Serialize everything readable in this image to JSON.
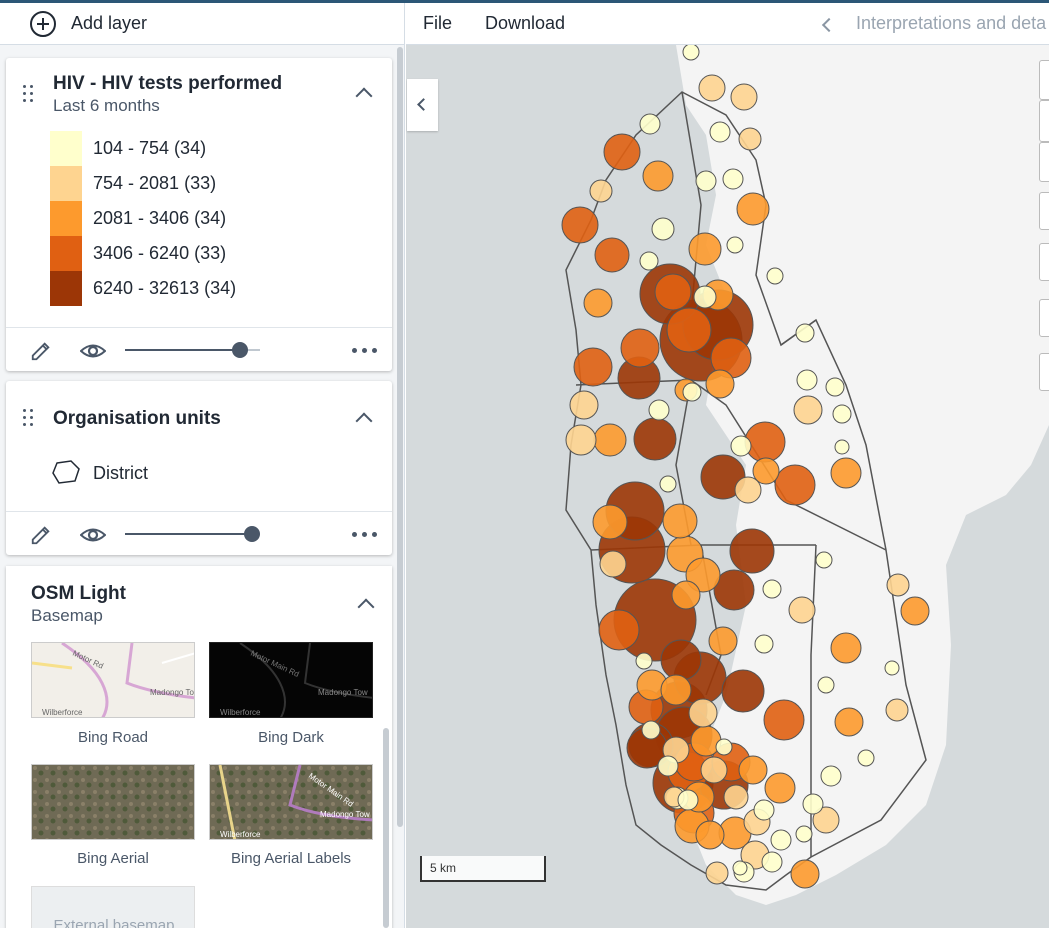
{
  "toolbar": {
    "add_layer": "Add layer"
  },
  "menu": {
    "file": "File",
    "download": "Download",
    "interpretations": "Interpretations and deta"
  },
  "layers": {
    "thematic": {
      "title": "HIV - HIV tests performed",
      "period": "Last 6 months",
      "legend": [
        {
          "label": "104 - 754 (34)",
          "color": "#ffffcc"
        },
        {
          "label": "754 - 2081 (33)",
          "color": "#fed490"
        },
        {
          "label": "2081 - 3406 (34)",
          "color": "#fd9a2d"
        },
        {
          "label": "3406 - 6240 (33)",
          "color": "#e06012"
        },
        {
          "label": "6240 - 32613 (34)",
          "color": "#9c3606"
        }
      ],
      "opacity": 0.9
    },
    "org_units": {
      "title": "Organisation units",
      "legend_label": "District",
      "opacity": 1.0
    },
    "basemap": {
      "title": "OSM Light",
      "subtitle": "Basemap",
      "options": [
        {
          "label": "Bing Road",
          "tile_label_1": "Motor Rd",
          "tile_label_2": "Madongo Tow",
          "tile_label_3": "Wilberforce"
        },
        {
          "label": "Bing Dark",
          "tile_label_1": "Motor Main Rd",
          "tile_label_2": "Madongo Tow",
          "tile_label_3": "Wilberforce"
        },
        {
          "label": "Bing Aerial"
        },
        {
          "label": "Bing Aerial Labels",
          "tile_label_1": "Motor Main Rd",
          "tile_label_2": "Madongo Tow",
          "tile_label_3": "Wilberforce"
        },
        {
          "label": "External basemap"
        }
      ]
    }
  },
  "map": {
    "scale_label": "5 km"
  },
  "colors": {
    "accent": "#2c5777",
    "water": "#d5dadc",
    "land": "#f5f5f5"
  }
}
